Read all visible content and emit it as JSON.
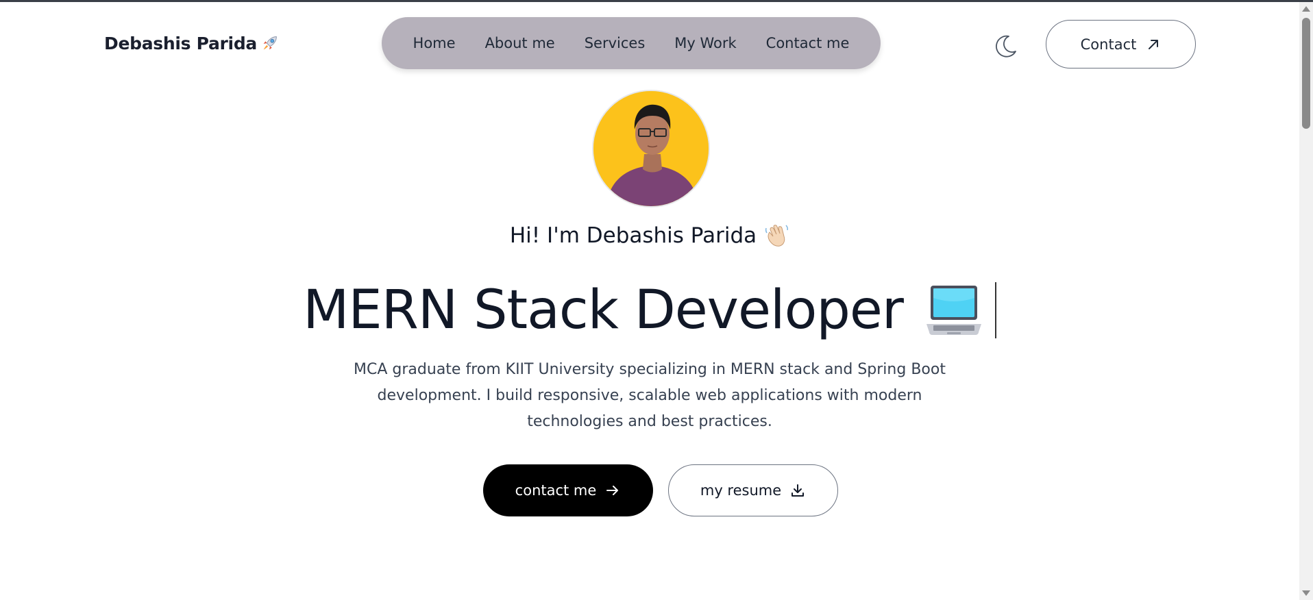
{
  "header": {
    "logo_text": "Debashis Parida",
    "logo_icon": "rocket-icon",
    "nav_items": [
      {
        "label": "Home"
      },
      {
        "label": "About me"
      },
      {
        "label": "Services"
      },
      {
        "label": "My Work"
      },
      {
        "label": "Contact me"
      }
    ],
    "theme_toggle_icon": "moon-icon",
    "contact_label": "Contact",
    "contact_icon": "arrow-up-right-icon"
  },
  "hero": {
    "greeting": "Hi! I'm Debashis Parida",
    "greeting_icon": "waving-hand-icon",
    "headline": "MERN Stack Developer",
    "headline_icon": "laptop-icon",
    "description": "MCA graduate from KIIT University specializing in MERN stack and Spring Boot development. I build responsive, scalable web applications with modern technologies and best practices.",
    "primary_button": {
      "label": "contact me",
      "icon": "arrow-right-icon"
    },
    "secondary_button": {
      "label": "my resume",
      "icon": "download-icon"
    }
  },
  "colors": {
    "navbar_bg": "#b6b1bb",
    "avatar_bg": "#fcc21b",
    "primary_button_bg": "#000000",
    "text_dark": "#111827"
  }
}
